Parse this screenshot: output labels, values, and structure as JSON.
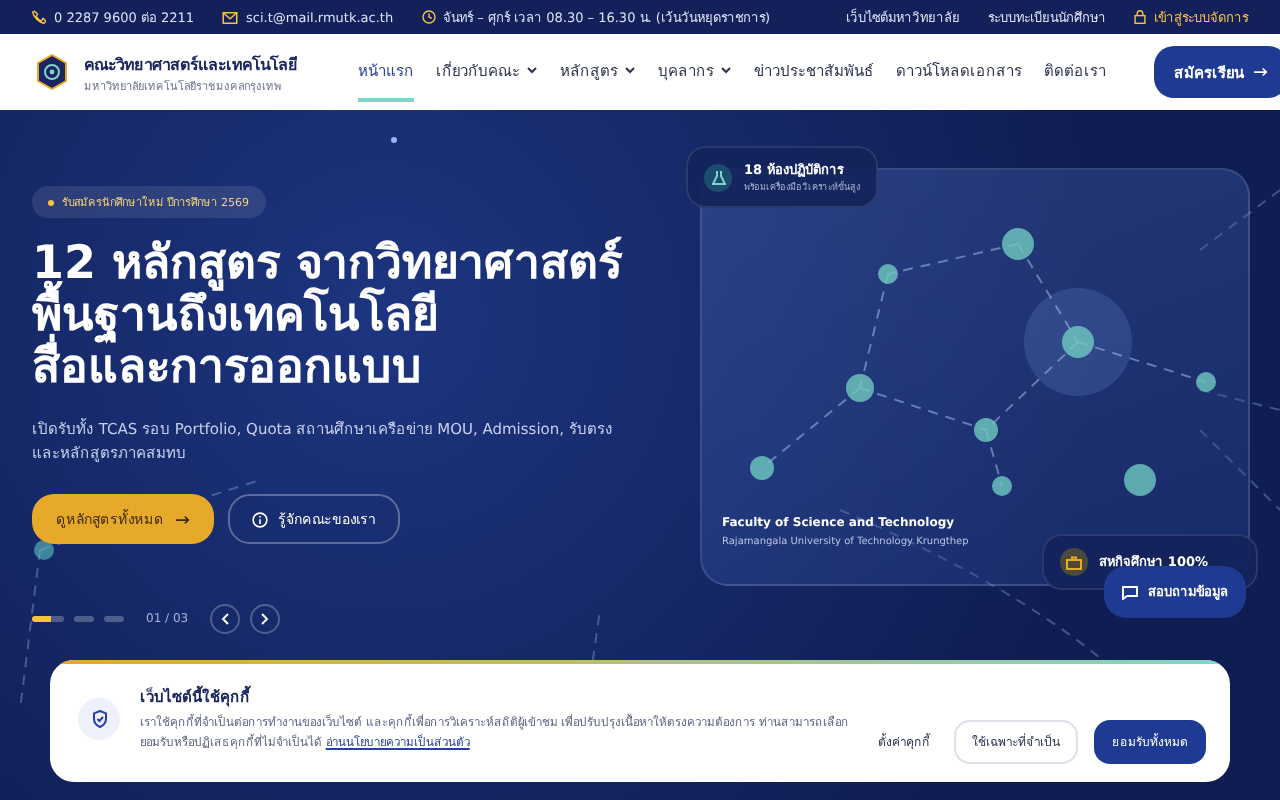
{
  "topbar": {
    "phone": "0 2287 9600 ต่อ 2211",
    "email": "sci.t@mail.rmutk.ac.th",
    "hours": "จันทร์ – ศุกร์ เวลา 08.30 – 16.30 น. (เว้นวันหยุดราชการ)",
    "links": [
      "เว็บไซต์มหาวิทยาลัย",
      "ระบบทะเบียนนักศึกษา"
    ],
    "login": "เข้าสู่ระบบจัดการ"
  },
  "header": {
    "title": "คณะวิทยาศาสตร์และเทคโนโลยี",
    "subtitle": "มหาวิทยาลัยเทคโนโลยีราชมงคลกรุงเทพ",
    "apply": "สมัครเรียน",
    "nav": [
      {
        "label": "หน้าแรก",
        "selected": true,
        "has_menu": false
      },
      {
        "label": "เกี่ยวกับคณะ",
        "selected": false,
        "has_menu": true
      },
      {
        "label": "หลักสูตร",
        "selected": false,
        "has_menu": true
      },
      {
        "label": "บุคลากร",
        "selected": false,
        "has_menu": true
      },
      {
        "label": "ข่าวประชาสัมพันธ์",
        "selected": false,
        "has_menu": false
      },
      {
        "label": "ดาวน์โหลดเอกสาร",
        "selected": false,
        "has_menu": false
      },
      {
        "label": "ติดต่อเรา",
        "selected": false,
        "has_menu": false
      }
    ]
  },
  "hero": {
    "badge": "รับสมัครนักศึกษาใหม่ ปีการศึกษา 2569",
    "title_lines": [
      "12 หลักสูตร จากวิทยาศาสตร์",
      "พื้นฐานถึงเทคโนโลยี",
      "สื่อและการออกแบบ"
    ],
    "description": "เปิดรับทั้ง TCAS รอบ Portfolio, Quota สถานศึกษาเครือข่าย MOU, Admission, รับตรง และหลักสูตรภาคสมทบ",
    "primary_button": "ดูหลักสูตรทั้งหมด",
    "secondary_button": "รู้จักคณะของเรา",
    "slide_counter": "01 / 03",
    "slides": [
      {
        "selected": true
      },
      {
        "selected": false
      },
      {
        "selected": false
      }
    ],
    "card": {
      "title": "Faculty of Science and Technology",
      "subtitle": "Rajamangala University of Technology Krungthep"
    },
    "lab_badge": {
      "title": "18 ห้องปฏิบัติการ",
      "subtitle": "พร้อมเครื่องมือวิเคราะห์ขั้นสูง"
    },
    "coop_badge": {
      "title": "สหกิจศึกษา 100%"
    },
    "chat_button": "สอบถามข้อมูล"
  },
  "cookie": {
    "title": "เว็บไซต์นี้ใช้คุกกี้",
    "text": "เราใช้คุกกี้ที่จำเป็นต่อการทำงานของเว็บไซต์ และคุกกี้เพื่อการวิเคราะห์สถิติผู้เข้าชม เพื่อปรับปรุงเนื้อหาให้ตรงความต้องการ ท่านสามารถเลือกยอมรับหรือปฏิเสธคุกกี้ที่ไม่จำเป็นได้",
    "link": "อ่านนโยบายความเป็นส่วนตัว",
    "settings": "ตั้งค่าคุกกี้",
    "necessary": "ใช้เฉพาะที่จำเป็น",
    "accept": "ยอมรับทั้งหมด"
  }
}
